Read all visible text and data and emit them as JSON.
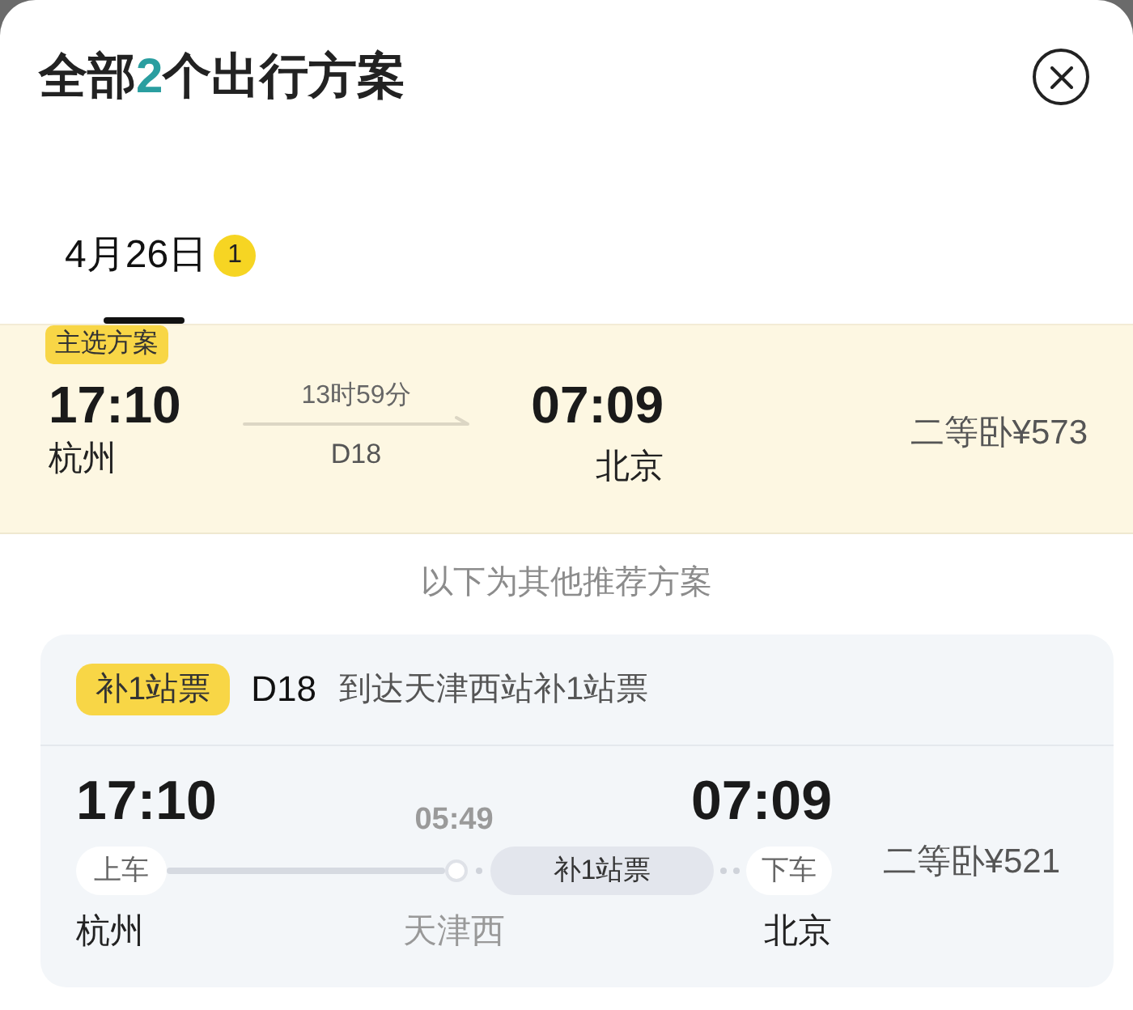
{
  "header": {
    "title_prefix": "全部",
    "title_count": "2",
    "title_suffix": "个出行方案"
  },
  "date_tabs": [
    {
      "label": "4月26日",
      "badge": "1",
      "selected": true
    }
  ],
  "primary_plan": {
    "tag": "主选方案",
    "depart_time": "17:10",
    "depart_station": "杭州",
    "duration": "13时59分",
    "train": "D18",
    "arrive_time": "07:09",
    "arrive_station": "北京",
    "fare": "二等卧¥573"
  },
  "other_heading": "以下为其他推荐方案",
  "other_plans": [
    {
      "tag": "补1站票",
      "train": "D18",
      "note": "到达天津西站补1站票",
      "depart_time": "17:10",
      "board_label": "上车",
      "depart_station": "杭州",
      "transfer_time": "05:49",
      "transfer_station": "天津西",
      "segment_label": "补1站票",
      "alight_label": "下车",
      "arrive_time": "07:09",
      "arrive_station": "北京",
      "fare": "二等卧¥521"
    }
  ]
}
